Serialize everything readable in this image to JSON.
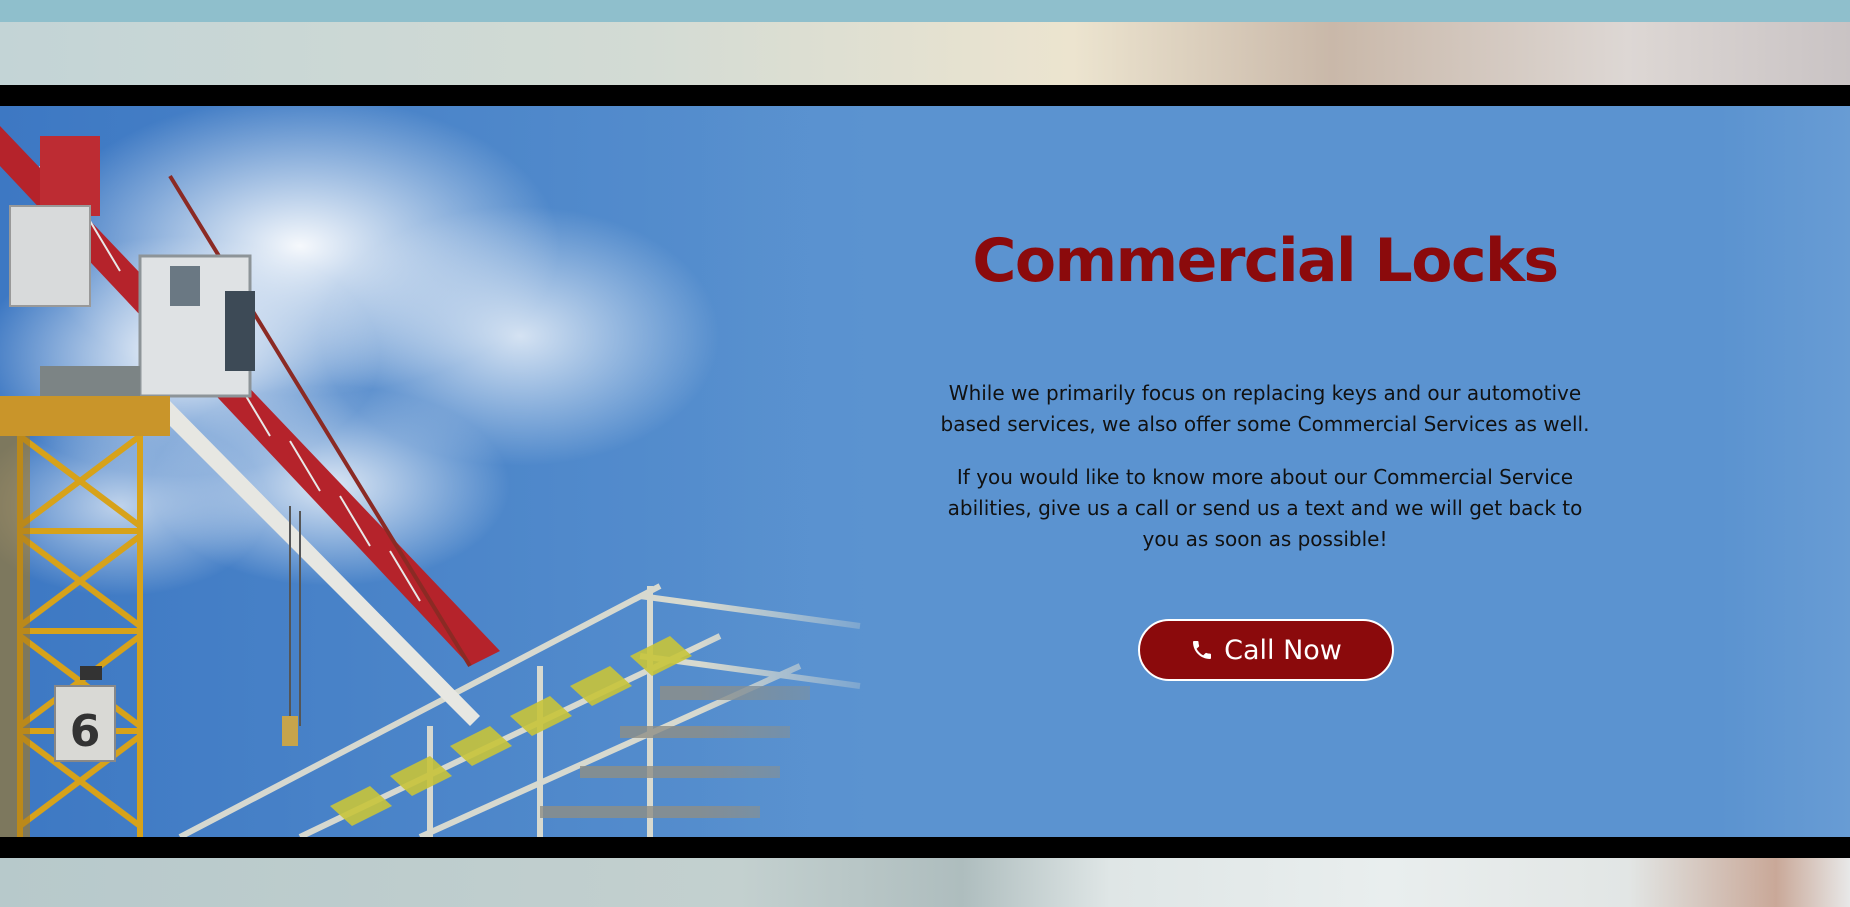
{
  "section": {
    "title": "Commercial Locks",
    "paragraph_1": "While we primarily focus on replacing keys and our automotive based services, we also offer some Commercial Services as well.",
    "paragraph_2": "If you would like to know more about our Commercial Service abilities, give us a call or send us a text and we will get back to you as soon as possible!",
    "cta": {
      "label": "Call Now",
      "icon": "phone-icon"
    }
  },
  "colors": {
    "accent": "#8b0a0c",
    "hero_background": "#5b93d0",
    "top_strip": "#8fbfcc",
    "divider": "#000000"
  }
}
